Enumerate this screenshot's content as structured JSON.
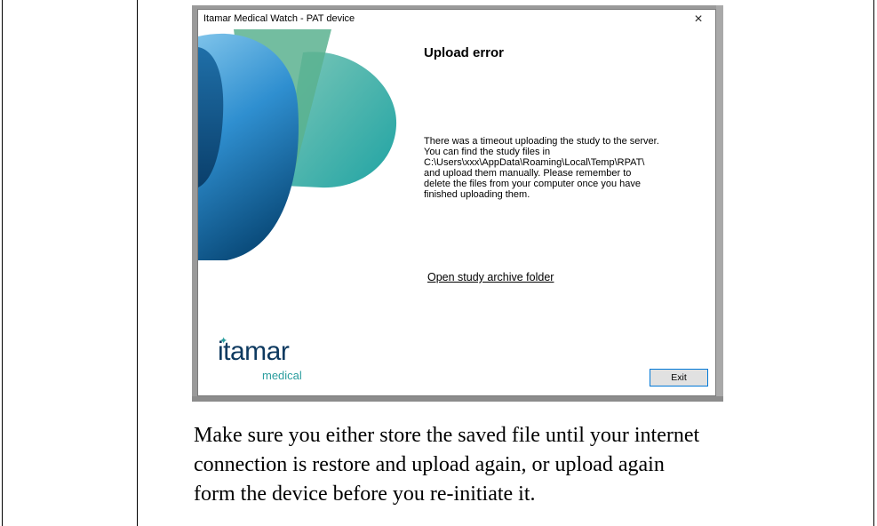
{
  "dialog": {
    "window_title": "Itamar Medical Watch - PAT device",
    "close_glyph": "×",
    "heading": "Upload error",
    "message_lines": [
      "There was a timeout uploading the study to the server.",
      "You can find the study files in",
      "C:\\Users\\xxx\\AppData\\Roaming\\Local\\Temp\\RPAT\\",
      "and upload them manually. Please remember to",
      "delete the files from your computer once you have",
      "finished uploading them."
    ],
    "link_label": "Open study archive folder",
    "logo": {
      "word": "itamar",
      "sub": "medical"
    },
    "exit_label": "Exit"
  },
  "instruction_lines": [
    "Make sure you either store the saved file until your internet",
    "connection is restore and upload again, or upload again",
    "form the device before you re-initiate it."
  ],
  "colors": {
    "brand_navy": "#0e3a60",
    "brand_teal": "#2a9d9e",
    "button_focus": "#0078d7"
  }
}
